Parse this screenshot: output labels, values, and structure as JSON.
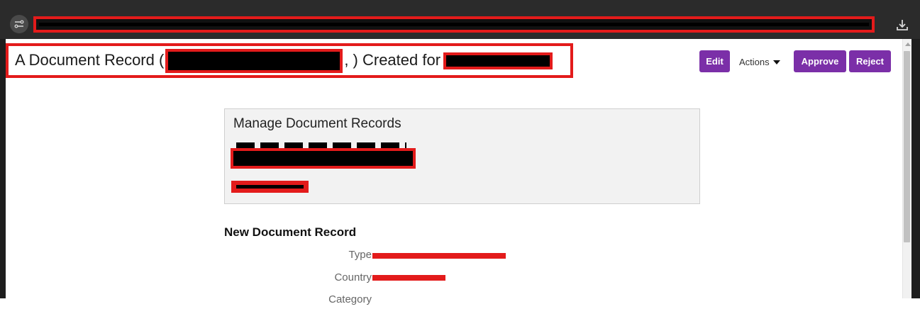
{
  "header": {
    "title_prefix": "A Document Record (",
    "title_middle": ", ) Created for"
  },
  "toolbar": {
    "edit_label": "Edit",
    "actions_label": "Actions",
    "approve_label": "Approve",
    "reject_label": "Reject"
  },
  "summary": {
    "heading": "Manage Document Records"
  },
  "section": {
    "title": "New Document Record",
    "fields": [
      {
        "label": "Type"
      },
      {
        "label": "Country"
      },
      {
        "label": "Category"
      }
    ]
  },
  "colors": {
    "brand": "#7b2fa8",
    "redaction": "#e31b1b",
    "topbar": "#2b2b2b"
  },
  "icons": {
    "tune": "tune-icon",
    "download": "download-icon",
    "caret": "caret-down-icon"
  }
}
